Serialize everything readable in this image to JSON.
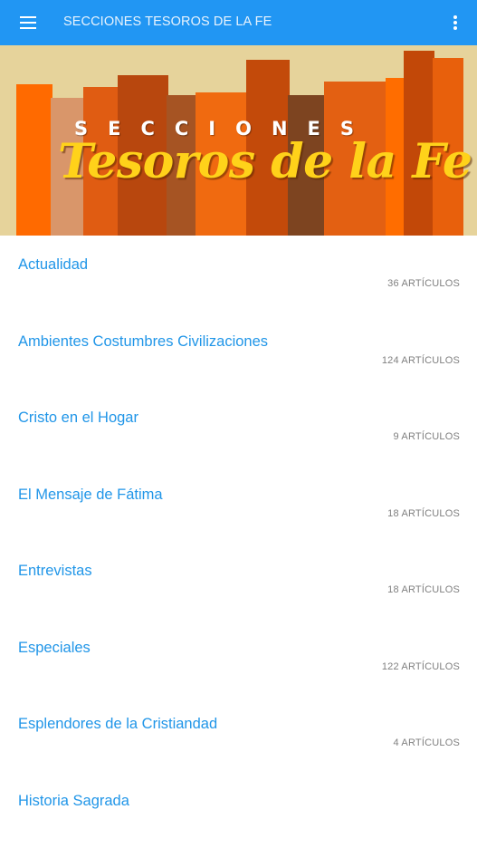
{
  "appbar": {
    "title": "SECCIONES TESOROS DE LA FE",
    "menu_icon": "hamburger-menu-icon",
    "overflow_icon": "more-vert-icon",
    "color": "#2196f3"
  },
  "banner": {
    "subtitle": "SECCIONES",
    "title": "Tesoros de la Fe"
  },
  "sections": [
    {
      "name": "Actualidad",
      "count": "36 ARTÍCULOS"
    },
    {
      "name": "Ambientes Costumbres Civilizaciones",
      "count": "124 ARTÍCULOS"
    },
    {
      "name": "Cristo en el Hogar",
      "count": "9 ARTÍCULOS"
    },
    {
      "name": "El Mensaje de Fátima",
      "count": "18 ARTÍCULOS"
    },
    {
      "name": "Entrevistas",
      "count": "18 ARTÍCULOS"
    },
    {
      "name": "Especiales",
      "count": "122 ARTÍCULOS"
    },
    {
      "name": "Esplendores de la Cristiandad",
      "count": "4 ARTÍCULOS"
    },
    {
      "name": "Historia Sagrada",
      "count": ""
    }
  ]
}
